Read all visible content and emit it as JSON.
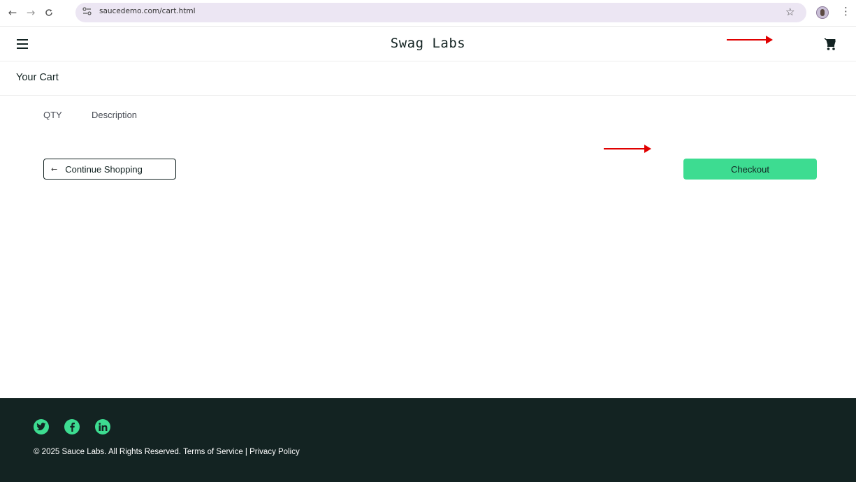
{
  "browser": {
    "url": "saucedemo.com/cart.html",
    "back_icon": "arrow-left-icon",
    "forward_icon": "arrow-right-icon",
    "reload_icon": "reload-icon",
    "star_icon": "bookmark-star-icon",
    "menu_icon": "kebab-menu-icon"
  },
  "header": {
    "title": "Swag Labs",
    "menu_icon": "hamburger-icon",
    "cart_icon": "shopping-cart-icon"
  },
  "secondary_header": {
    "title": "Your Cart"
  },
  "cart_list": {
    "qty_label": "QTY",
    "description_label": "Description"
  },
  "actions": {
    "continue_shopping_label": "Continue Shopping",
    "checkout_label": "Checkout"
  },
  "footer": {
    "social": [
      "twitter-icon",
      "facebook-icon",
      "linkedin-icon"
    ],
    "copyright": "© 2025 Sauce Labs. All Rights Reserved. Terms of Service | Privacy Policy"
  },
  "colors": {
    "accent": "#3ddc91",
    "dark": "#132322",
    "annotation": "#e00000"
  }
}
